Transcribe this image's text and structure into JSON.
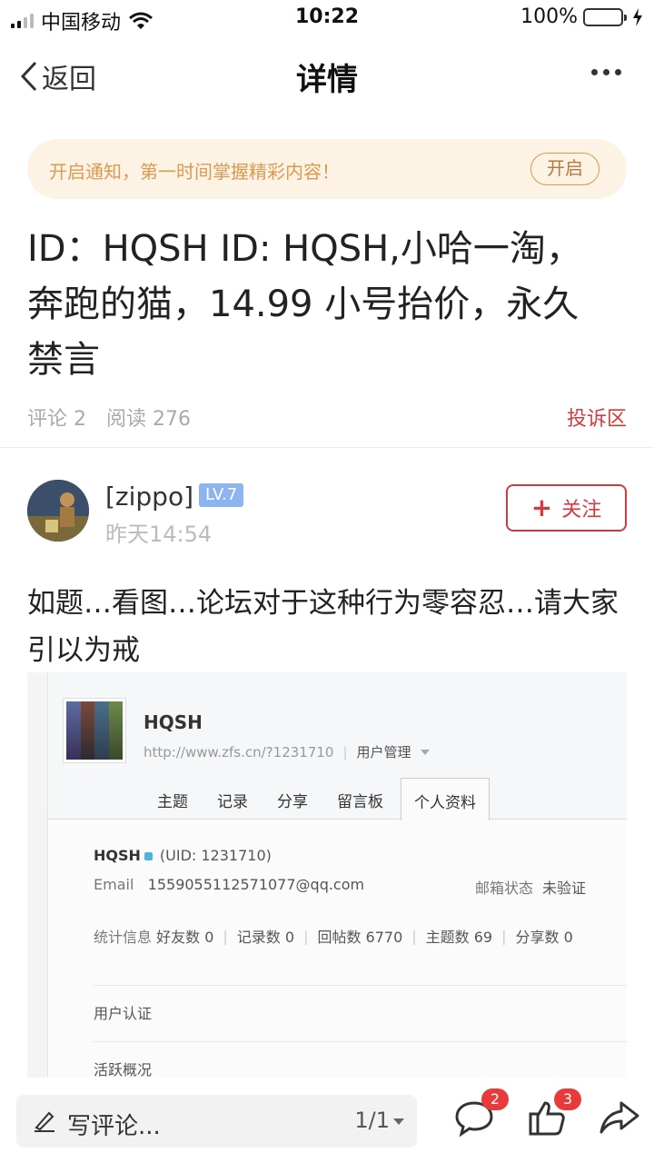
{
  "status_bar": {
    "carrier": "中国移动",
    "time": "10:22",
    "battery": "100%"
  },
  "nav": {
    "back_label": "返回",
    "title": "详情"
  },
  "notice": {
    "text": "开启通知，第一时间掌握精彩内容！",
    "button": "开启"
  },
  "post": {
    "title": "ID：HQSH ID: HQSH,小哈一淘，奔跑的猫，14.99 小号抬价，永久禁言",
    "comments": "评论 2",
    "reads": "阅读 276",
    "report": "投诉区",
    "body": "如题…看图…论坛对于这种行为零容忍…请大家引以为戒"
  },
  "author": {
    "name": "[zippo]",
    "level": "LV.7",
    "time": "昨天14:54",
    "follow_plus": "+",
    "follow_label": "关注"
  },
  "screenshot": {
    "username": "HQSH",
    "url": "http://www.zfs.cn/?1231710",
    "manage": "用户管理",
    "tabs": [
      "主题",
      "记录",
      "分享",
      "留言板",
      "个人资料"
    ],
    "active_tab": "个人资料",
    "uid_name": "HQSH",
    "uid": "(UID: 1231710)",
    "email_label": "Email",
    "email_value": "1559055112571077@qq.com",
    "mail_state_label": "邮箱状态",
    "mail_state_value": "未验证",
    "stats_label": "统计信息",
    "stats": [
      "好友数 0",
      "记录数 0",
      "回帖数 6770",
      "主题数 69",
      "分享数 0"
    ],
    "verify": "用户认证",
    "activity": "活跃概况"
  },
  "bottom": {
    "comment_placeholder": "写评论...",
    "pager": "1/1",
    "comment_count": "2",
    "like_count": "3"
  },
  "colors": {
    "accent_red": "#d6393b",
    "notice_bg": "#fdf3e4",
    "notice_text": "#d99a52",
    "level_badge": "#8db4ef",
    "battery": "#4cd964"
  },
  "icons": [
    "signal-icon",
    "wifi-icon",
    "battery-icon",
    "charging-icon",
    "back-chevron-icon",
    "more-icon",
    "pen-icon",
    "dropdown-icon",
    "comment-icon",
    "like-icon",
    "share-icon"
  ]
}
